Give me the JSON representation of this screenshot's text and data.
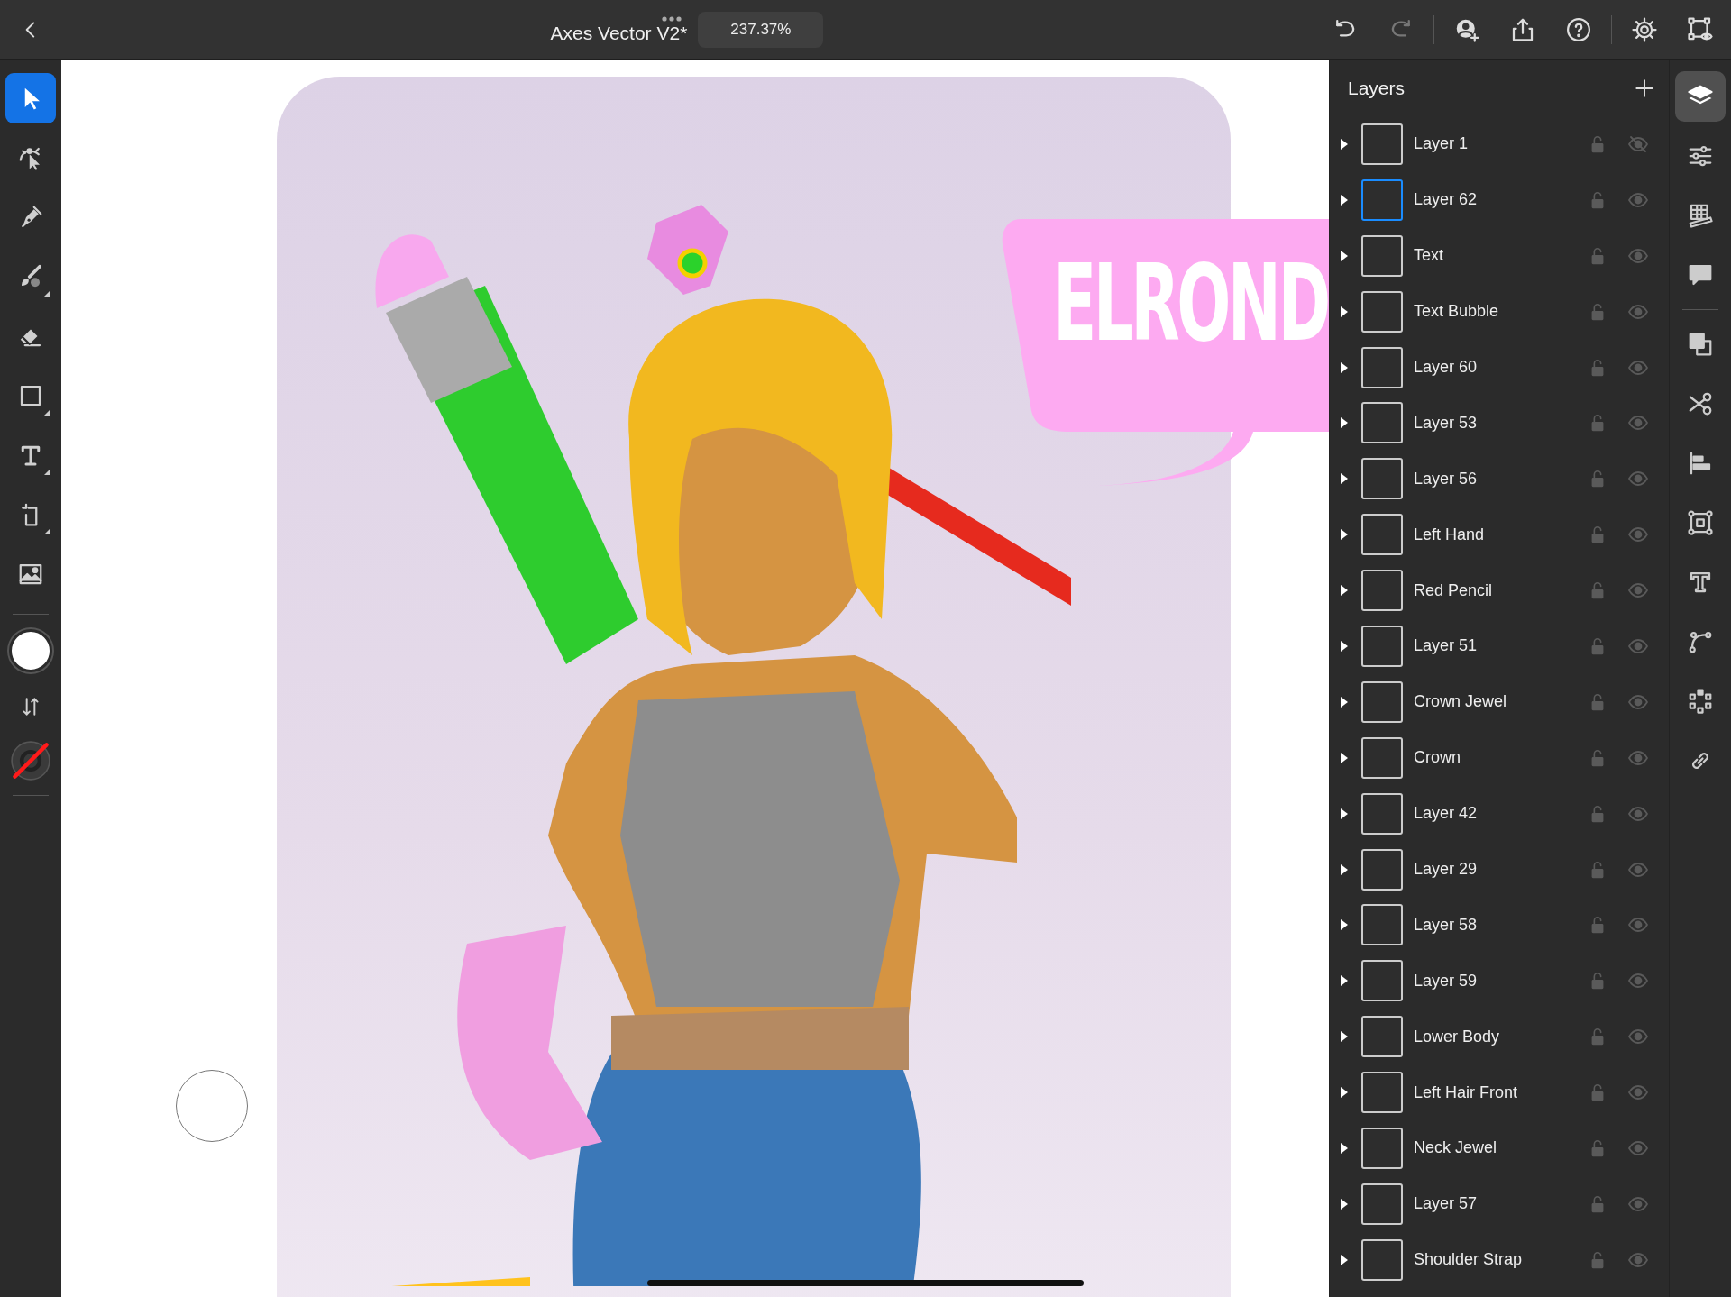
{
  "topbar": {
    "title": "Axes Vector V2*",
    "zoom": "237.37%"
  },
  "tools": [
    {
      "kind": "select",
      "selected": true
    },
    {
      "kind": "direct",
      "selected": false
    },
    {
      "kind": "pen",
      "selected": false
    },
    {
      "kind": "brush",
      "selected": false
    },
    {
      "kind": "eraser",
      "selected": false
    },
    {
      "kind": "rect",
      "selected": false
    },
    {
      "kind": "type",
      "selected": false
    },
    {
      "kind": "transform",
      "selected": false
    },
    {
      "kind": "image",
      "selected": false
    }
  ],
  "artboard": {
    "bubble_text": "ELROND"
  },
  "layers_panel": {
    "title": "Layers",
    "layers": [
      {
        "name": "Layer 1",
        "selected": false,
        "visible": false
      },
      {
        "name": "Layer 62",
        "selected": true,
        "visible": true
      },
      {
        "name": "Text",
        "selected": false,
        "visible": true
      },
      {
        "name": "Text Bubble",
        "selected": false,
        "visible": true
      },
      {
        "name": "Layer 60",
        "selected": false,
        "visible": true
      },
      {
        "name": "Layer 53",
        "selected": false,
        "visible": true
      },
      {
        "name": "Layer 56",
        "selected": false,
        "visible": true
      },
      {
        "name": "Left Hand",
        "selected": false,
        "visible": true
      },
      {
        "name": "Red Pencil",
        "selected": false,
        "visible": true
      },
      {
        "name": "Layer 51",
        "selected": false,
        "visible": true
      },
      {
        "name": "Crown Jewel",
        "selected": false,
        "visible": true
      },
      {
        "name": "Crown",
        "selected": false,
        "visible": true
      },
      {
        "name": "Layer 42",
        "selected": false,
        "visible": true
      },
      {
        "name": "Layer 29",
        "selected": false,
        "visible": true
      },
      {
        "name": "Layer 58",
        "selected": false,
        "visible": true
      },
      {
        "name": "Layer 59",
        "selected": false,
        "visible": true
      },
      {
        "name": "Lower Body",
        "selected": false,
        "visible": true
      },
      {
        "name": "Left Hair Front",
        "selected": false,
        "visible": true
      },
      {
        "name": "Neck Jewel",
        "selected": false,
        "visible": true
      },
      {
        "name": "Layer 57",
        "selected": false,
        "visible": true
      },
      {
        "name": "Shoulder Strap",
        "selected": false,
        "visible": true
      }
    ]
  },
  "side_icons": [
    {
      "kind": "layers",
      "selected": true
    },
    {
      "kind": "properties",
      "selected": false
    },
    {
      "kind": "grid",
      "selected": false
    },
    {
      "kind": "comment",
      "selected": false
    },
    {
      "kind": "divider"
    },
    {
      "kind": "arrange",
      "selected": false
    },
    {
      "kind": "cut",
      "selected": false
    },
    {
      "kind": "align",
      "selected": false
    },
    {
      "kind": "transform",
      "selected": false
    },
    {
      "kind": "type",
      "selected": false
    },
    {
      "kind": "path",
      "selected": false
    },
    {
      "kind": "repeat",
      "selected": false
    },
    {
      "kind": "link",
      "selected": false
    }
  ]
}
